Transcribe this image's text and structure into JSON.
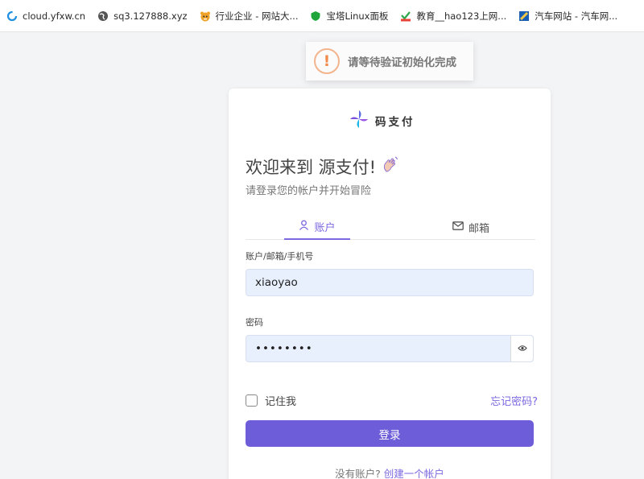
{
  "bookmarks": [
    {
      "label": "cloud.yfxw.cn",
      "icon": "cloud-swirl-icon"
    },
    {
      "label": "sq3.127888.xyz",
      "icon": "globe-icon"
    },
    {
      "label": "行业企业 - 网站大...",
      "icon": "tiger-icon"
    },
    {
      "label": "宝塔Linux面板",
      "icon": "shield-icon"
    },
    {
      "label": "教育__hao123上网...",
      "icon": "hao123-icon"
    },
    {
      "label": "汽车网站 - 汽车网...",
      "icon": "car-site-icon"
    }
  ],
  "toast": {
    "text": "请等待验证初始化完成",
    "icon": "exclamation-icon"
  },
  "brand": {
    "name": "码支付",
    "icon": "pinwheel-logo-icon"
  },
  "welcome": {
    "title": "欢迎来到 源支付!",
    "emoji": "waving-hand-icon",
    "subtitle": "请登录您的帐户并开始冒险"
  },
  "tabs": [
    {
      "label": "账户",
      "icon": "user-icon",
      "active": true
    },
    {
      "label": "邮箱",
      "icon": "mail-icon",
      "active": false
    }
  ],
  "form": {
    "account_label": "账户/邮箱/手机号",
    "account_value": "xiaoyao",
    "password_label": "密码",
    "password_value": "••••••••",
    "remember_label": "记住我",
    "forgot_label": "忘记密码?",
    "submit_label": "登录"
  },
  "signup": {
    "prompt": "没有账户?",
    "link": "创建一个帐户"
  },
  "colors": {
    "accent": "#7c68e0",
    "button": "#6d5dd8",
    "input_bg": "#e8f0fe",
    "toast_icon": "#f08b4c"
  }
}
